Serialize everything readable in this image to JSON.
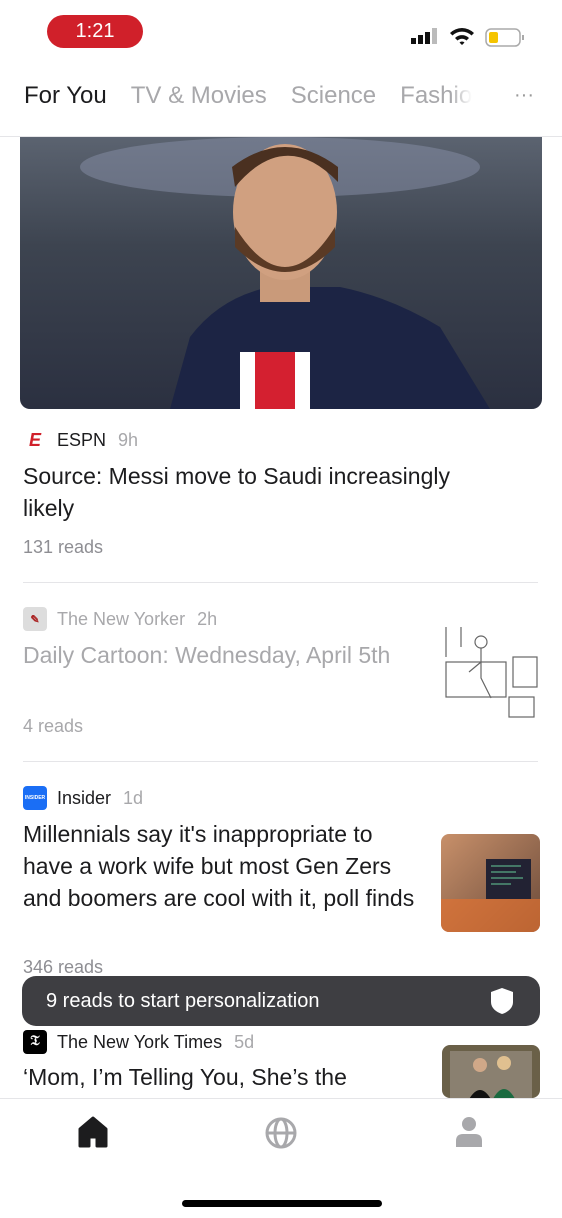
{
  "status_bar": {
    "time": "1:21",
    "battery_color": "#f5c400"
  },
  "tabs": [
    {
      "label": "For You",
      "active": true
    },
    {
      "label": "TV & Movies"
    },
    {
      "label": "Science"
    },
    {
      "label": "Fashio"
    }
  ],
  "more_label": "···",
  "articles": [
    {
      "source": "ESPN",
      "age": "9h",
      "headline": "Source: Messi move to Saudi increasingly likely",
      "reads": "131 reads"
    },
    {
      "source": "The New Yorker",
      "age": "2h",
      "headline": "Daily Cartoon: Wednesday, April 5th",
      "reads": "4 reads"
    },
    {
      "source": "Insider",
      "age": "1d",
      "headline": "Millennials say it's inappropriate to have a work wife but most Gen Zers and boomers are cool with it, poll finds",
      "reads": "346 reads"
    },
    {
      "source": "The New York Times",
      "age": "5d",
      "headline": "‘Mom, I’m Telling You, She’s the"
    }
  ],
  "toast": {
    "text": "9 reads to start personalization"
  },
  "nav": [
    {
      "icon": "home-icon",
      "active": true
    },
    {
      "icon": "globe-icon"
    },
    {
      "icon": "profile-icon"
    }
  ],
  "colors": {
    "accent": "#d0202a",
    "toast_bg": "#323236"
  }
}
